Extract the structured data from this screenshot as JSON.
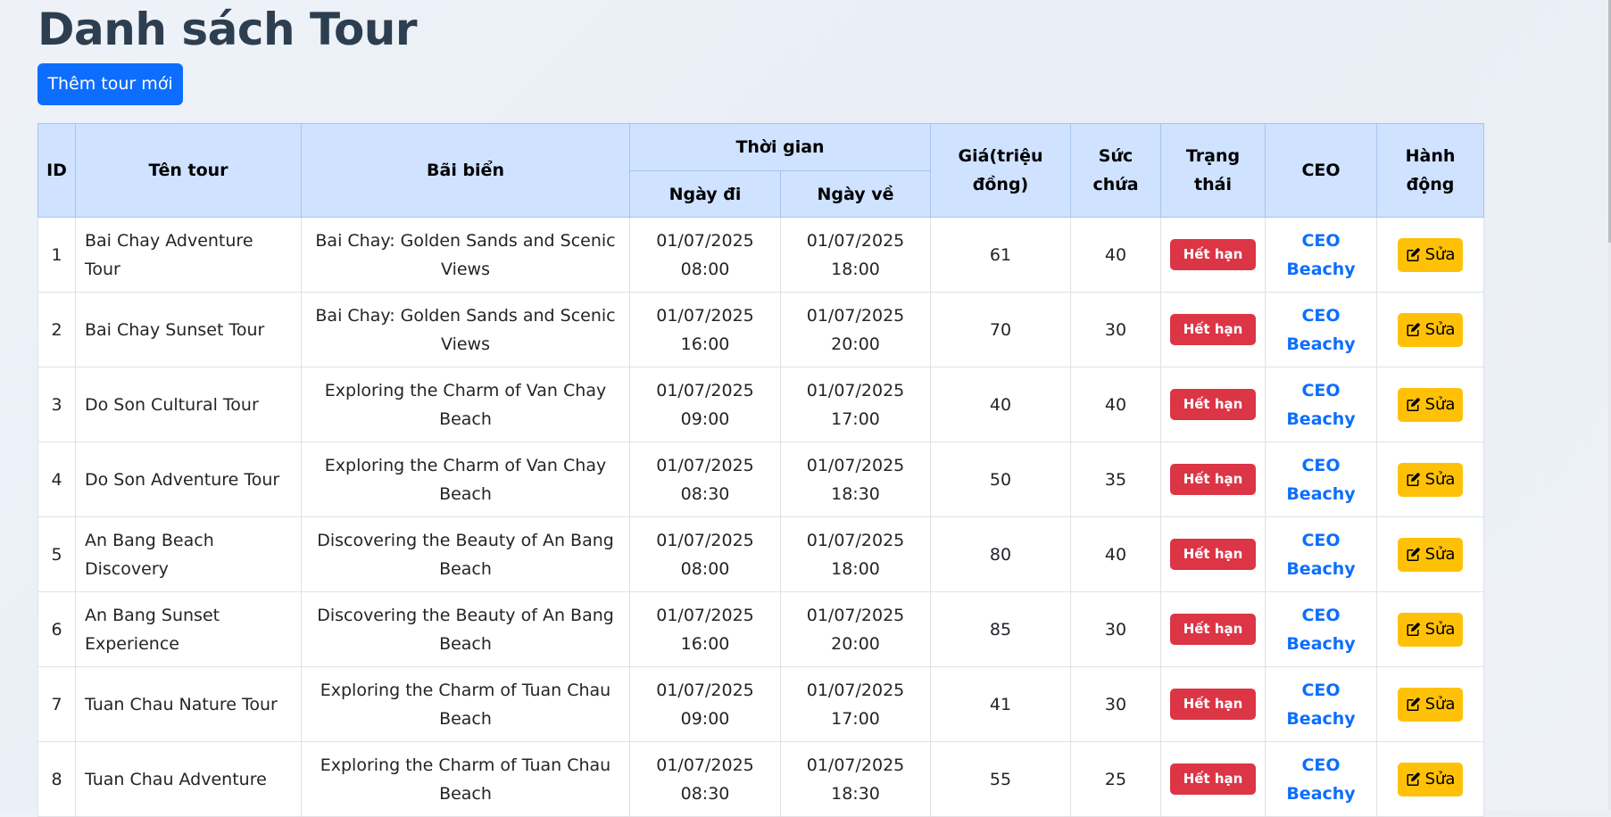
{
  "page": {
    "title": "Danh sách Tour",
    "add_button_label": "Thêm tour mới"
  },
  "table": {
    "headers": {
      "id": "ID",
      "name": "Tên tour",
      "beach": "Bãi biển",
      "time": "Thời gian",
      "depart": "Ngày đi",
      "return": "Ngày về",
      "price": "Giá(triệu đồng)",
      "capacity": "Sức chứa",
      "status": "Trạng thái",
      "ceo": "CEO",
      "action": "Hành động"
    },
    "rows": [
      {
        "id": "1",
        "name": "Bai Chay Adventure Tour",
        "beach": "Bai Chay: Golden Sands and Scenic Views",
        "depart": "01/07/2025 08:00",
        "return": "01/07/2025 18:00",
        "price": "61",
        "capacity": "40",
        "status": "Hết hạn",
        "ceo": "CEO Beachy",
        "action": "Sửa"
      },
      {
        "id": "2",
        "name": "Bai Chay Sunset Tour",
        "beach": "Bai Chay: Golden Sands and Scenic Views",
        "depart": "01/07/2025 16:00",
        "return": "01/07/2025 20:00",
        "price": "70",
        "capacity": "30",
        "status": "Hết hạn",
        "ceo": "CEO Beachy",
        "action": "Sửa"
      },
      {
        "id": "3",
        "name": "Do Son Cultural Tour",
        "beach": "Exploring the Charm of Van Chay Beach",
        "depart": "01/07/2025 09:00",
        "return": "01/07/2025 17:00",
        "price": "40",
        "capacity": "40",
        "status": "Hết hạn",
        "ceo": "CEO Beachy",
        "action": "Sửa"
      },
      {
        "id": "4",
        "name": "Do Son Adventure Tour",
        "beach": "Exploring the Charm of Van Chay Beach",
        "depart": "01/07/2025 08:30",
        "return": "01/07/2025 18:30",
        "price": "50",
        "capacity": "35",
        "status": "Hết hạn",
        "ceo": "CEO Beachy",
        "action": "Sửa"
      },
      {
        "id": "5",
        "name": "An Bang Beach Discovery",
        "beach": "Discovering the Beauty of An Bang Beach",
        "depart": "01/07/2025 08:00",
        "return": "01/07/2025 18:00",
        "price": "80",
        "capacity": "40",
        "status": "Hết hạn",
        "ceo": "CEO Beachy",
        "action": "Sửa"
      },
      {
        "id": "6",
        "name": "An Bang Sunset Experience",
        "beach": "Discovering the Beauty of An Bang Beach",
        "depart": "01/07/2025 16:00",
        "return": "01/07/2025 20:00",
        "price": "85",
        "capacity": "30",
        "status": "Hết hạn",
        "ceo": "CEO Beachy",
        "action": "Sửa"
      },
      {
        "id": "7",
        "name": "Tuan Chau Nature Tour",
        "beach": "Exploring the Charm of Tuan Chau Beach",
        "depart": "01/07/2025 09:00",
        "return": "01/07/2025 17:00",
        "price": "41",
        "capacity": "30",
        "status": "Hết hạn",
        "ceo": "CEO Beachy",
        "action": "Sửa"
      },
      {
        "id": "8",
        "name": "Tuan Chau Adventure",
        "beach": "Exploring the Charm of Tuan Chau Beach",
        "depart": "01/07/2025 08:30",
        "return": "01/07/2025 18:30",
        "price": "55",
        "capacity": "25",
        "status": "Hết hạn",
        "ceo": "CEO Beachy",
        "action": "Sửa"
      }
    ]
  },
  "icons": {
    "edit": "pencil-square-icon"
  },
  "colors": {
    "primary": "#0d6efd",
    "danger": "#dc3545",
    "warning": "#ffc107",
    "header_bg": "#cfe2ff"
  }
}
